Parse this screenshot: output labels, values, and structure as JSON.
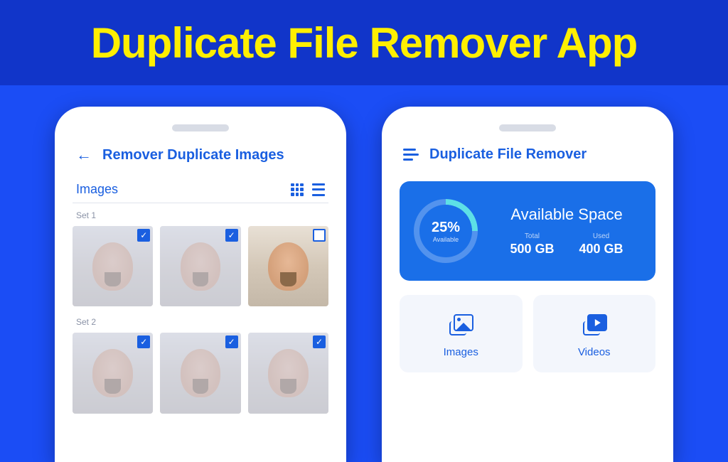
{
  "header": {
    "title": "Duplicate File Remover App"
  },
  "screen1": {
    "title": "Remover Duplicate Images",
    "section_label": "Images",
    "sets": [
      {
        "label": "Set 1"
      },
      {
        "label": "Set 2"
      }
    ]
  },
  "screen2": {
    "title": "Duplicate File Remover",
    "storage": {
      "title": "Available Space",
      "percent": "25%",
      "percent_label": "Available",
      "total_label": "Total",
      "total_value": "500 GB",
      "used_label": "Used",
      "used_value": "400 GB"
    },
    "categories": [
      {
        "label": "Images"
      },
      {
        "label": "Videos"
      }
    ]
  },
  "chart_data": {
    "type": "pie",
    "title": "Available Space",
    "series": [
      {
        "name": "Available",
        "value": 25
      },
      {
        "name": "Used",
        "value": 75
      }
    ],
    "annotations": {
      "total": "500 GB",
      "used": "400 GB"
    }
  }
}
